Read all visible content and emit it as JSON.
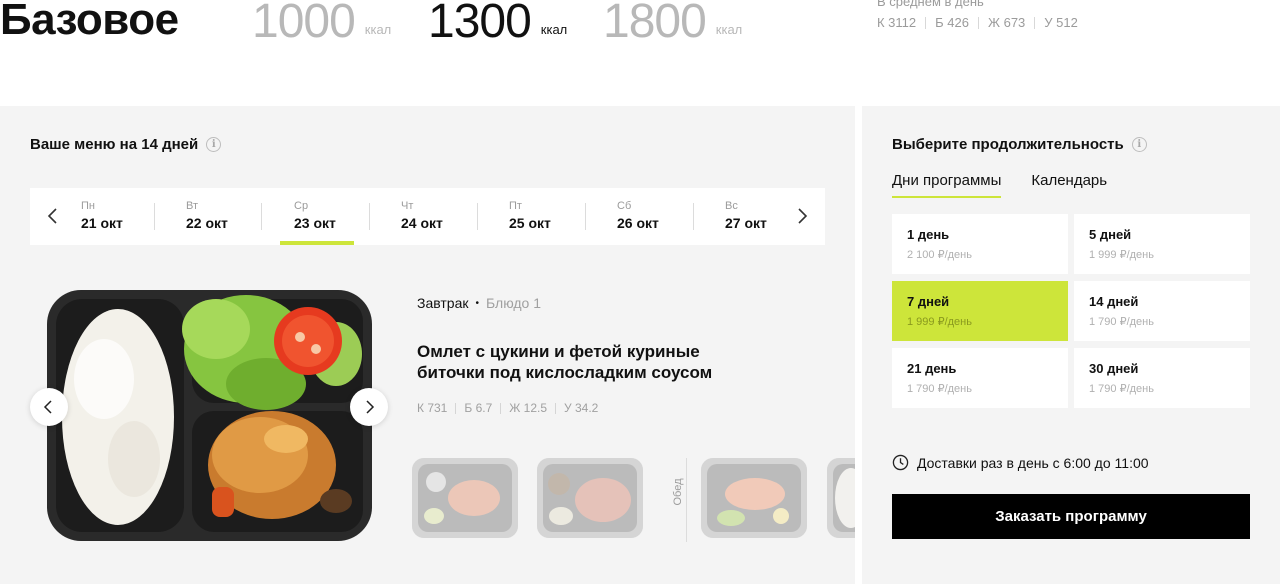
{
  "plan": {
    "title": "Базовое",
    "calories": [
      {
        "value": "1000",
        "unit": "ккал",
        "active": false
      },
      {
        "value": "1300",
        "unit": "ккал",
        "active": true
      },
      {
        "value": "1800",
        "unit": "ккал",
        "active": false
      }
    ],
    "average": {
      "label": "В среднем в день",
      "macros": [
        "К 3112",
        "Б 426",
        "Ж 673",
        "У 512"
      ]
    }
  },
  "menu": {
    "title": "Ваше меню на 14 дней",
    "days": [
      {
        "weekday": "Пн",
        "date": "21 окт",
        "active": false
      },
      {
        "weekday": "Вт",
        "date": "22 окт",
        "active": false
      },
      {
        "weekday": "Ср",
        "date": "23 окт",
        "active": true
      },
      {
        "weekday": "Чт",
        "date": "24 окт",
        "active": false
      },
      {
        "weekday": "Пт",
        "date": "25 окт",
        "active": false
      },
      {
        "weekday": "Сб",
        "date": "26 окт",
        "active": false
      },
      {
        "weekday": "Вс",
        "date": "27 окт",
        "active": false
      }
    ],
    "dish": {
      "meal": "Завтрак",
      "number": "Блюдо 1",
      "name": "Омлет с цукини и фетой куриные биточки под кислосладким соусом",
      "macros": [
        "К 731",
        "Б 6.7",
        "Ж 12.5",
        "У 34.2"
      ]
    },
    "lunch_label": "Обед"
  },
  "duration": {
    "title": "Выберите продолжительность",
    "tabs": [
      "Дни программы",
      "Календарь"
    ],
    "options": [
      {
        "label": "1 день",
        "price": "2 100 ₽/день",
        "active": false
      },
      {
        "label": "5 дней",
        "price": "1 999 ₽/день",
        "active": false
      },
      {
        "label": "7 дней",
        "price": "1 999 ₽/день",
        "active": true
      },
      {
        "label": "14 дней",
        "price": "1 790 ₽/день",
        "active": false
      },
      {
        "label": "21 день",
        "price": "1 790 ₽/день",
        "active": false
      },
      {
        "label": "30 дней",
        "price": "1 790 ₽/день",
        "active": false
      }
    ],
    "delivery": "Доставки раз в день с 6:00 до 11:00",
    "order_button": "Заказать программу"
  },
  "colors": {
    "accent": "#cde53a",
    "panel": "#f4f4f4",
    "button": "#000000"
  }
}
